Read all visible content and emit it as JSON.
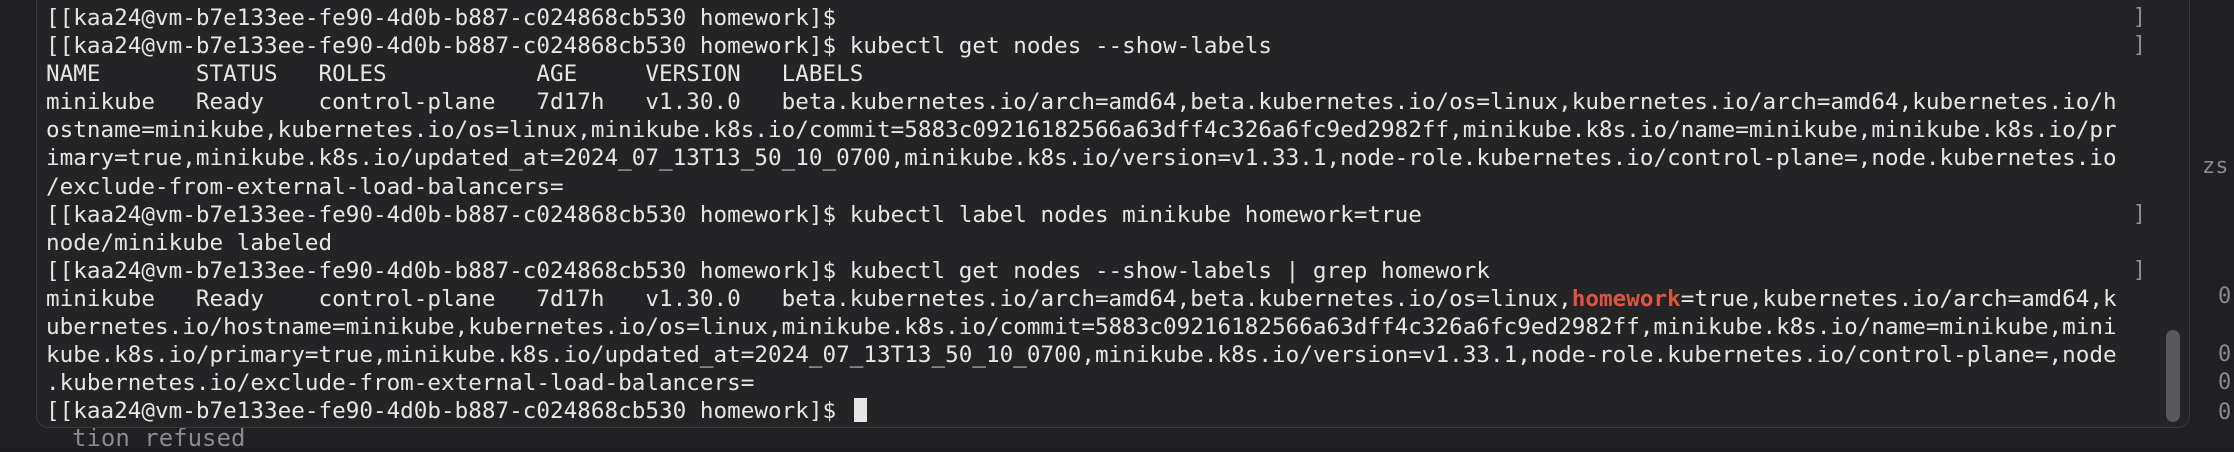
{
  "background": {
    "right_fragments": [
      "zs",
      "0.",
      "0.",
      "0.",
      "0."
    ],
    "bottom_fragment": "tion refused"
  },
  "terminal": {
    "lines": [
      {
        "text": "[[kaa24@vm-b7e133ee-fe90-4d0b-b887-c024868cb530 homework]$",
        "bracket": "]"
      },
      {
        "text": "[[kaa24@vm-b7e133ee-fe90-4d0b-b887-c024868cb530 homework]$ kubectl get nodes --show-labels",
        "bracket": "]"
      },
      {
        "text": "NAME       STATUS   ROLES           AGE     VERSION   LABELS",
        "bracket": ""
      },
      {
        "text": "minikube   Ready    control-plane   7d17h   v1.30.0   beta.kubernetes.io/arch=amd64,beta.kubernetes.io/os=linux,kubernetes.io/arch=amd64,kubernetes.io/h",
        "bracket": ""
      },
      {
        "text": "ostname=minikube,kubernetes.io/os=linux,minikube.k8s.io/commit=5883c09216182566a63dff4c326a6fc9ed2982ff,minikube.k8s.io/name=minikube,minikube.k8s.io/pr",
        "bracket": ""
      },
      {
        "text": "imary=true,minikube.k8s.io/updated_at=2024_07_13T13_50_10_0700,minikube.k8s.io/version=v1.33.1,node-role.kubernetes.io/control-plane=,node.kubernetes.io",
        "bracket": ""
      },
      {
        "text": "/exclude-from-external-load-balancers=",
        "bracket": ""
      },
      {
        "text": "[[kaa24@vm-b7e133ee-fe90-4d0b-b887-c024868cb530 homework]$ kubectl label nodes minikube homework=true",
        "bracket": "]"
      },
      {
        "text": "node/minikube labeled",
        "bracket": ""
      },
      {
        "text": "[[kaa24@vm-b7e133ee-fe90-4d0b-b887-c024868cb530 homework]$ kubectl get nodes --show-labels | grep homework",
        "bracket": "]"
      },
      {
        "pre": "minikube   Ready    control-plane   7d17h   v1.30.0   beta.kubernetes.io/arch=amd64,beta.kubernetes.io/os=linux,",
        "highlight": "homework",
        "post": "=true,kubernetes.io/arch=amd64,k",
        "bracket": ""
      },
      {
        "text": "ubernetes.io/hostname=minikube,kubernetes.io/os=linux,minikube.k8s.io/commit=5883c09216182566a63dff4c326a6fc9ed2982ff,minikube.k8s.io/name=minikube,mini",
        "bracket": ""
      },
      {
        "text": "kube.k8s.io/primary=true,minikube.k8s.io/updated_at=2024_07_13T13_50_10_0700,minikube.k8s.io/version=v1.33.1,node-role.kubernetes.io/control-plane=,node",
        "bracket": ""
      },
      {
        "text": ".kubernetes.io/exclude-from-external-load-balancers=",
        "bracket": ""
      },
      {
        "text": "[[kaa24@vm-b7e133ee-fe90-4d0b-b887-c024868cb530 homework]$ ",
        "bracket": "",
        "cursor": true
      }
    ]
  },
  "colors": {
    "terminal_bg": "#242426",
    "text": "#e6e6e6",
    "grep_highlight": "#e0543f"
  }
}
